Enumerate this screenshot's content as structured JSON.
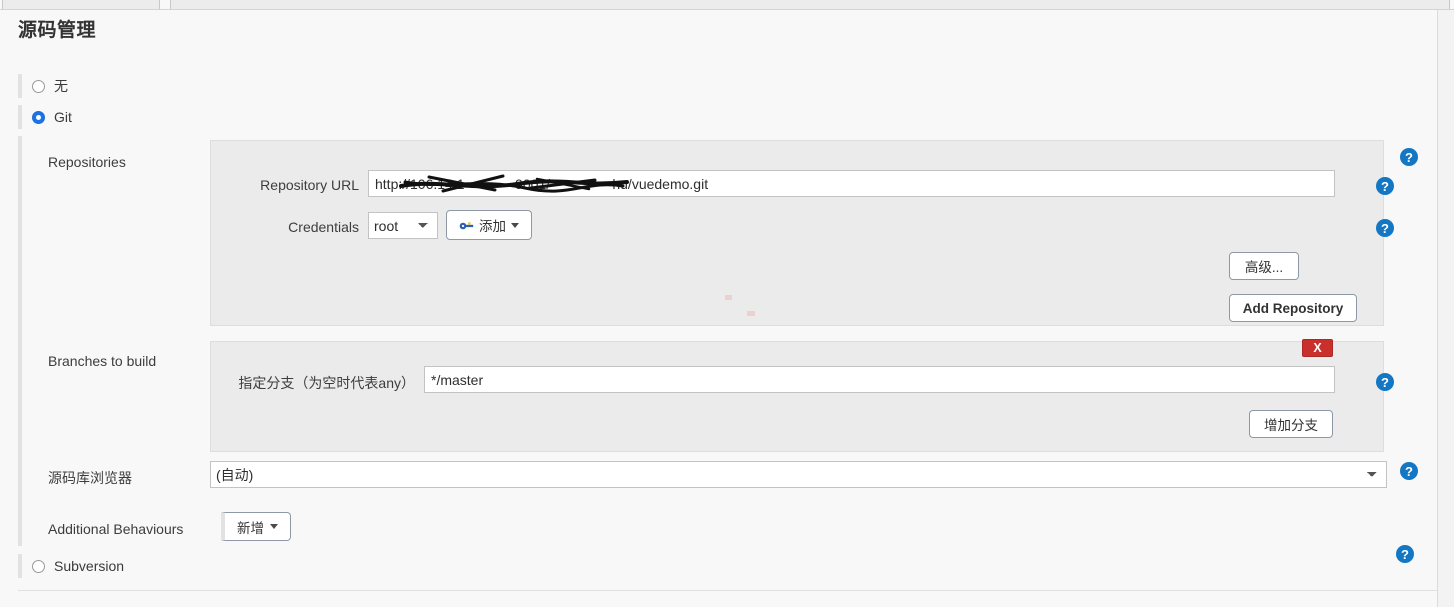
{
  "window": {
    "tabs": [
      "",
      ""
    ]
  },
  "page": {
    "title": "源码管理"
  },
  "scm_options": [
    {
      "id": "none",
      "label": "无",
      "selected": false
    },
    {
      "id": "git",
      "label": "Git",
      "selected": true
    },
    {
      "id": "subversion",
      "label": "Subversion",
      "selected": false
    }
  ],
  "git": {
    "repositories": {
      "label": "Repositories",
      "repository_url": {
        "label": "Repository URL",
        "value": "http://106.14.1             9001/                hu/vuedemo.git",
        "redacted": true
      },
      "credentials": {
        "label": "Credentials",
        "selected": "root",
        "options": [
          "root"
        ],
        "add_button": {
          "label": "添加",
          "icon": "key-icon",
          "has_caret": true
        }
      },
      "advanced_button": "高级...",
      "add_repository_button": "Add Repository"
    },
    "branches": {
      "label": "Branches to build",
      "branch_spec": {
        "label": "指定分支（为空时代表any）",
        "value": "*/master"
      },
      "delete_button": "X",
      "add_branch_button": "增加分支"
    },
    "repository_browser": {
      "label": "源码库浏览器",
      "selected": "(自动)",
      "options": [
        "(自动)"
      ]
    },
    "additional_behaviours": {
      "label": "Additional Behaviours",
      "add_button": {
        "label": "新增",
        "has_caret": true
      }
    }
  },
  "help_icon": "?",
  "colors": {
    "accent_blue": "#1a73e8",
    "help_blue": "#1477c4",
    "delete_red": "#c9302c",
    "panel_bg": "#ebebeb",
    "page_bg": "#f8f8f8"
  }
}
